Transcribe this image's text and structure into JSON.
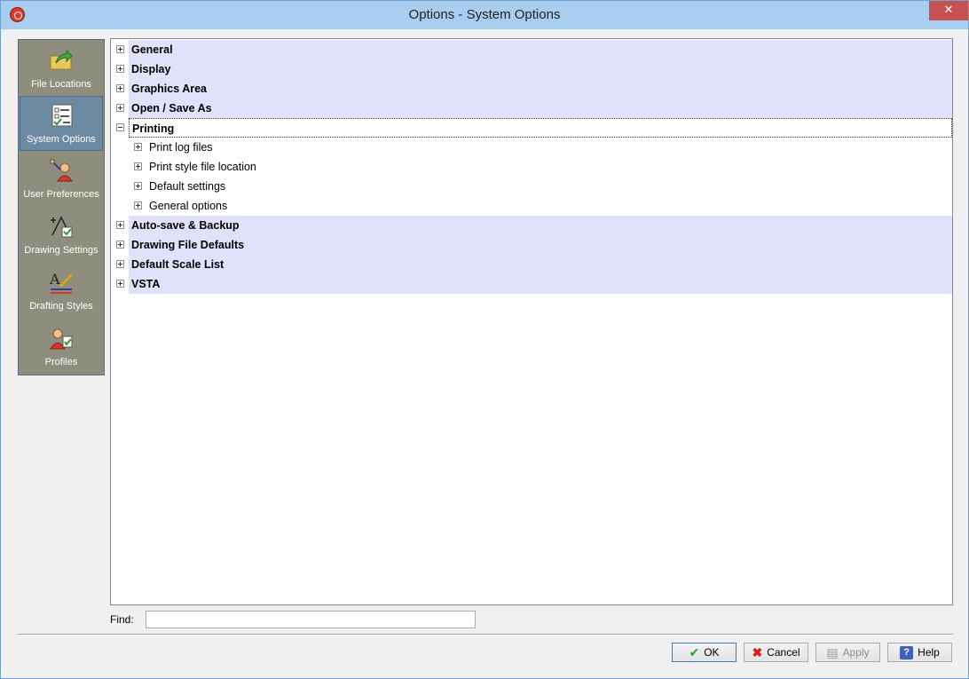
{
  "window": {
    "title": "Options - System Options",
    "close_glyph": "✕"
  },
  "sidebar": {
    "items": [
      {
        "label": "File Locations",
        "icon": "folder-arrow-icon",
        "selected": false
      },
      {
        "label": "System Options",
        "icon": "checklist-icon",
        "selected": true
      },
      {
        "label": "User Preferences",
        "icon": "user-preferences-icon",
        "selected": false
      },
      {
        "label": "Drawing Settings",
        "icon": "drawing-settings-icon",
        "selected": false
      },
      {
        "label": "Drafting Styles",
        "icon": "drafting-styles-icon",
        "selected": false
      },
      {
        "label": "Profiles",
        "icon": "profiles-icon",
        "selected": false
      }
    ]
  },
  "tree": {
    "nodes": [
      {
        "label": "General",
        "expanded": false
      },
      {
        "label": "Display",
        "expanded": false
      },
      {
        "label": "Graphics Area",
        "expanded": false
      },
      {
        "label": "Open / Save As",
        "expanded": false
      },
      {
        "label": "Printing",
        "expanded": true,
        "children": [
          "Print log files",
          "Print style file location",
          "Default settings",
          "General options"
        ]
      },
      {
        "label": "Auto-save & Backup",
        "expanded": false
      },
      {
        "label": "Drawing File Defaults",
        "expanded": false
      },
      {
        "label": "Default Scale List",
        "expanded": false
      },
      {
        "label": "VSTA",
        "expanded": false
      }
    ]
  },
  "find": {
    "label": "Find:",
    "value": ""
  },
  "buttons": {
    "ok": "OK",
    "cancel": "Cancel",
    "apply": "Apply",
    "help": "Help"
  },
  "colors": {
    "tree_section_bg": "#e1e1fb",
    "sidebar_bg": "#8e8e7e",
    "sidebar_selected": "#6d8aa3",
    "titlebar": "#a9cdee",
    "ok_check": "#2e9a2e",
    "cancel_x": "#d62020"
  }
}
